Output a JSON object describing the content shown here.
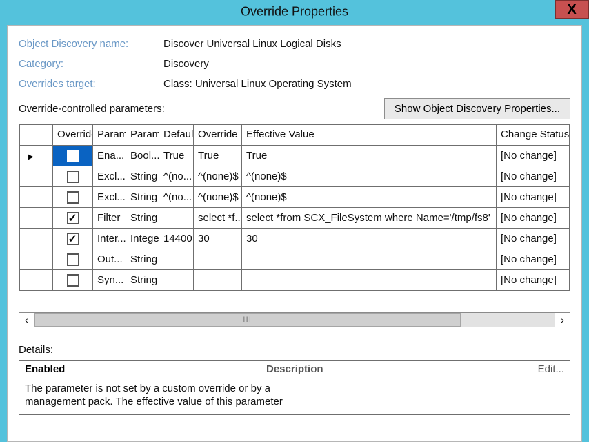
{
  "window": {
    "title": "Override Properties",
    "close": "X"
  },
  "fields": {
    "discoveryNameLabel": "Object Discovery name:",
    "discoveryNameValue": "Discover Universal Linux Logical Disks",
    "categoryLabel": "Category:",
    "categoryValue": "Discovery",
    "targetLabel": "Overrides target:",
    "targetValue": "Class: Universal Linux Operating System"
  },
  "paramsSection": {
    "label": "Override-controlled parameters:",
    "showBtn": "Show Object Discovery Properties..."
  },
  "gridHeaders": {
    "override": "Override",
    "paramName": "Param…",
    "paramType": "Param…",
    "defaultVal": "Default",
    "overrideVal": "Override",
    "effective": "Effective Value",
    "change": "Change Status"
  },
  "rows": [
    {
      "active": true,
      "override": false,
      "pname": "Ena...",
      "ptype": "Bool...",
      "dval": "True",
      "oval": "True",
      "eff": "True",
      "chg": "[No change]"
    },
    {
      "active": false,
      "override": false,
      "pname": "Excl...",
      "ptype": "String",
      "dval": "^(no...",
      "oval": "^(none)$",
      "eff": "^(none)$",
      "chg": "[No change]"
    },
    {
      "active": false,
      "override": false,
      "pname": "Excl...",
      "ptype": "String",
      "dval": "^(no...",
      "oval": "^(none)$",
      "eff": "^(none)$",
      "chg": "[No change]"
    },
    {
      "active": false,
      "override": true,
      "pname": "Filter",
      "ptype": "String",
      "dval": "",
      "oval": "select *f...",
      "eff": "select *from SCX_FileSystem where Name='/tmp/fs8'",
      "chg": "[No change]"
    },
    {
      "active": false,
      "override": true,
      "pname": "Inter...",
      "ptype": "Integer",
      "dval": "14400",
      "oval": "30",
      "eff": "30",
      "chg": "[No change]"
    },
    {
      "active": false,
      "override": false,
      "pname": "Out...",
      "ptype": "String",
      "dval": "",
      "oval": "",
      "eff": "",
      "chg": "[No change]"
    },
    {
      "active": false,
      "override": false,
      "pname": "Syn...",
      "ptype": "String",
      "dval": "",
      "oval": "",
      "eff": "",
      "chg": "[No change]"
    }
  ],
  "details": {
    "label": "Details:",
    "nameHeader": "Enabled",
    "descHeader": "Description",
    "edit": "Edit...",
    "body1": "The parameter is not set by a custom override or by a",
    "body2": "management pack. The effective value of this parameter"
  }
}
